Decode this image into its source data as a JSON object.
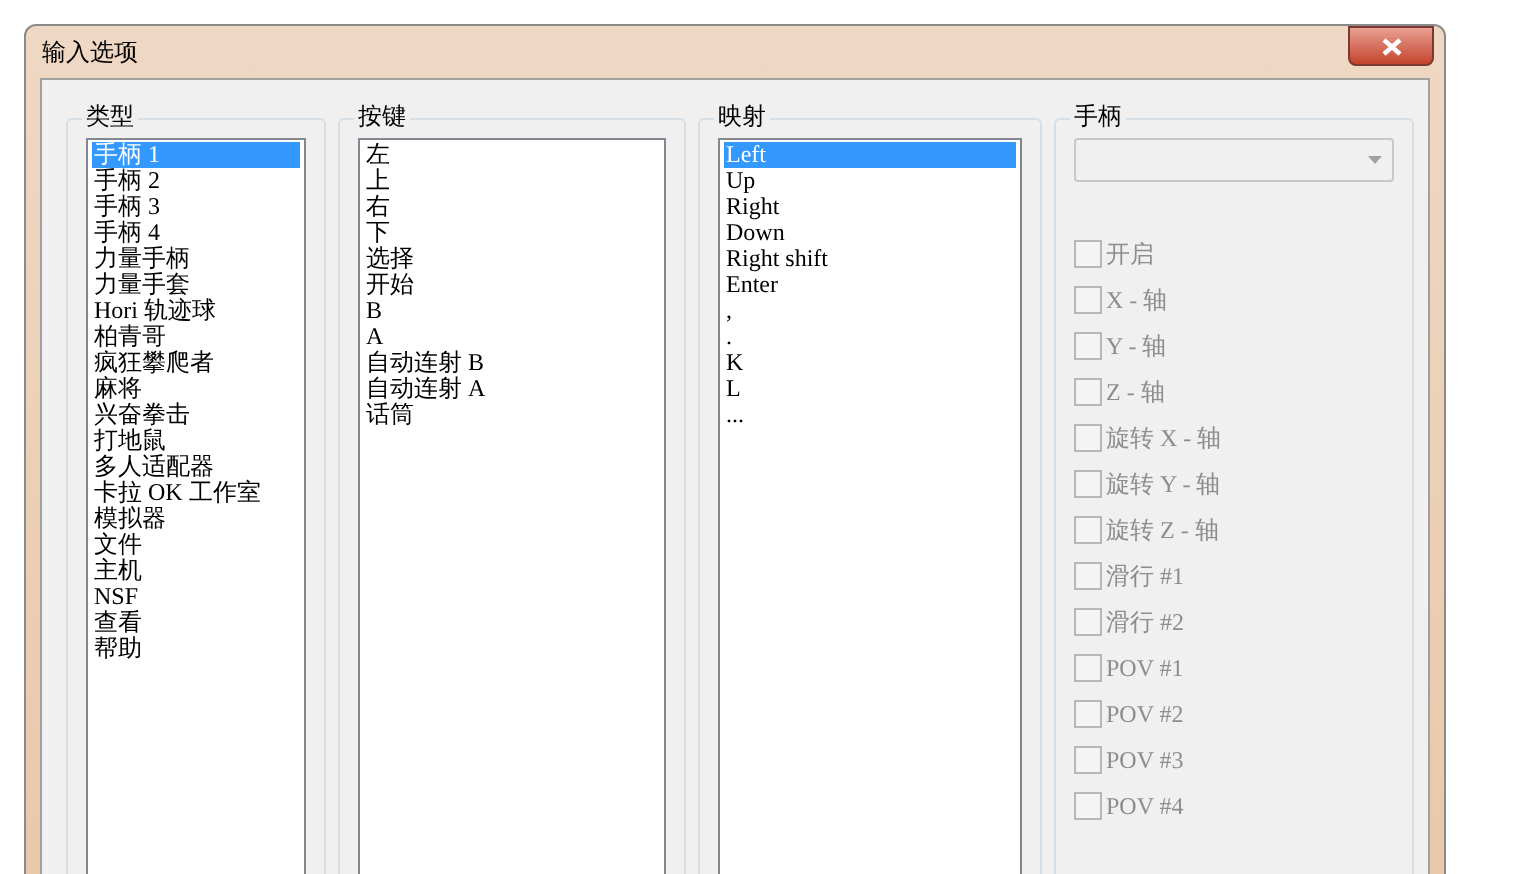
{
  "window": {
    "title": "输入选项"
  },
  "type_group": {
    "label": "类型",
    "items": [
      {
        "text": "手柄 1",
        "selected": true
      },
      {
        "text": "手柄 2",
        "selected": false
      },
      {
        "text": "手柄 3",
        "selected": false
      },
      {
        "text": "手柄 4",
        "selected": false
      },
      {
        "text": "力量手柄",
        "selected": false
      },
      {
        "text": "力量手套",
        "selected": false
      },
      {
        "text": "Hori 轨迹球",
        "selected": false
      },
      {
        "text": "柏青哥",
        "selected": false
      },
      {
        "text": "疯狂攀爬者",
        "selected": false
      },
      {
        "text": "麻将",
        "selected": false
      },
      {
        "text": "兴奋拳击",
        "selected": false
      },
      {
        "text": "打地鼠",
        "selected": false
      },
      {
        "text": "多人适配器",
        "selected": false
      },
      {
        "text": "卡拉 OK 工作室",
        "selected": false
      },
      {
        "text": "模拟器",
        "selected": false
      },
      {
        "text": "文件",
        "selected": false
      },
      {
        "text": "主机",
        "selected": false
      },
      {
        "text": "NSF",
        "selected": false
      },
      {
        "text": "查看",
        "selected": false
      },
      {
        "text": "帮助",
        "selected": false
      }
    ]
  },
  "key_group": {
    "label": "按键",
    "items": [
      {
        "text": "左",
        "selected": false
      },
      {
        "text": "上",
        "selected": false
      },
      {
        "text": "右",
        "selected": false
      },
      {
        "text": "下",
        "selected": false
      },
      {
        "text": "选择",
        "selected": false
      },
      {
        "text": "开始",
        "selected": false
      },
      {
        "text": "B",
        "selected": false
      },
      {
        "text": "A",
        "selected": false
      },
      {
        "text": "自动连射 B",
        "selected": false
      },
      {
        "text": "自动连射 A",
        "selected": false
      },
      {
        "text": "话筒",
        "selected": false
      }
    ]
  },
  "mapping_group": {
    "label": "映射",
    "items": [
      {
        "text": "Left",
        "selected": true
      },
      {
        "text": "Up",
        "selected": false
      },
      {
        "text": "Right",
        "selected": false
      },
      {
        "text": "Down",
        "selected": false
      },
      {
        "text": "Right shift",
        "selected": false
      },
      {
        "text": "Enter",
        "selected": false
      },
      {
        "text": ",",
        "selected": false
      },
      {
        "text": ".",
        "selected": false
      },
      {
        "text": "K",
        "selected": false
      },
      {
        "text": "L",
        "selected": false
      },
      {
        "text": "...",
        "selected": false
      }
    ]
  },
  "joystick_group": {
    "label": "手柄",
    "dropdown": {
      "disabled": true
    },
    "checkboxes": [
      {
        "label": "开启",
        "checked": false,
        "disabled": true
      },
      {
        "label": "X - 轴",
        "checked": false,
        "disabled": true
      },
      {
        "label": "Y - 轴",
        "checked": false,
        "disabled": true
      },
      {
        "label": "Z - 轴",
        "checked": false,
        "disabled": true
      },
      {
        "label": "旋转 X - 轴",
        "checked": false,
        "disabled": true
      },
      {
        "label": "旋转 Y - 轴",
        "checked": false,
        "disabled": true
      },
      {
        "label": "旋转 Z - 轴",
        "checked": false,
        "disabled": true
      },
      {
        "label": "滑行 #1",
        "checked": false,
        "disabled": true
      },
      {
        "label": "滑行 #2",
        "checked": false,
        "disabled": true
      },
      {
        "label": "POV #1",
        "checked": false,
        "disabled": true
      },
      {
        "label": "POV #2",
        "checked": false,
        "disabled": true
      },
      {
        "label": "POV #3",
        "checked": false,
        "disabled": true
      },
      {
        "label": "POV #4",
        "checked": false,
        "disabled": true
      }
    ]
  }
}
